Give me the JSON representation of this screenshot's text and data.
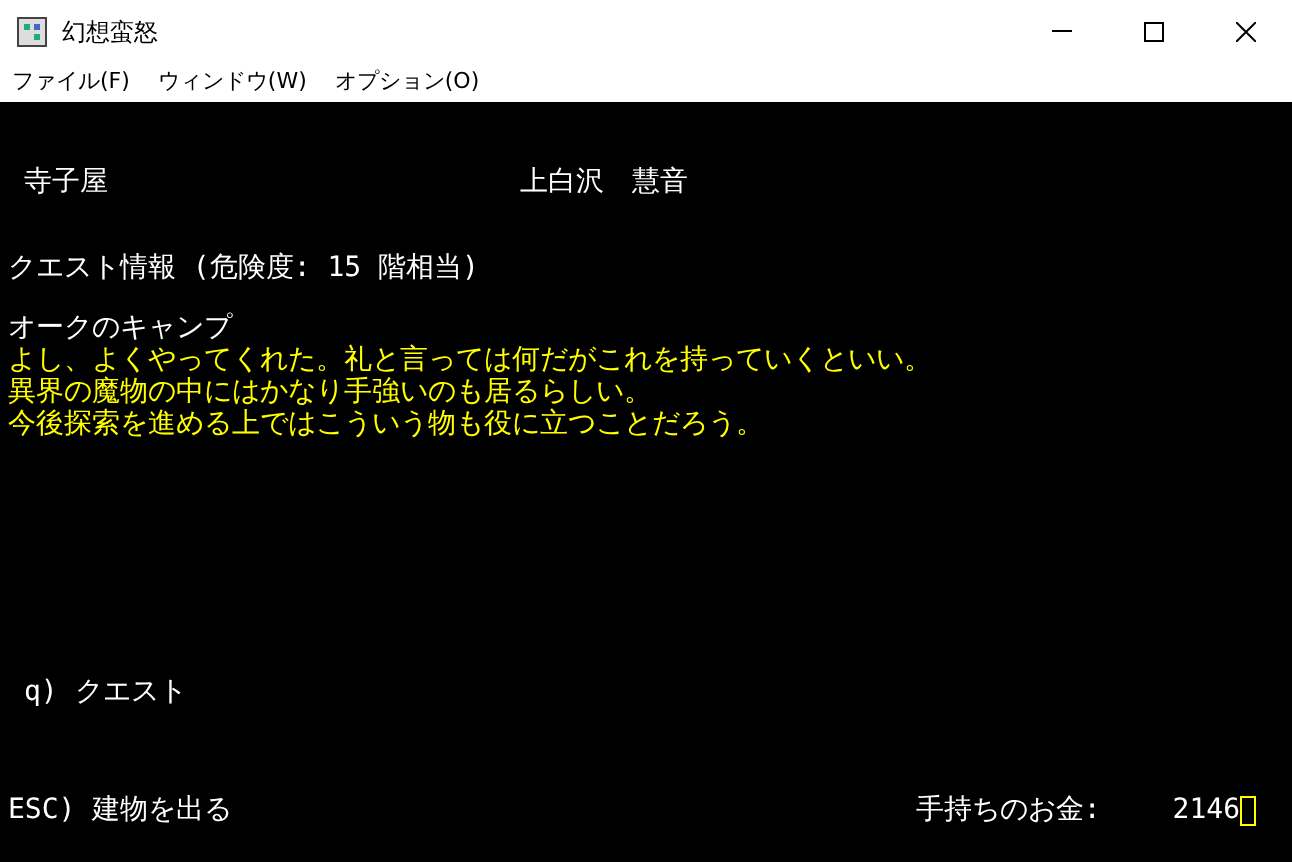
{
  "window": {
    "title": "幻想蛮怒"
  },
  "menu": [
    {
      "label": "ファイル(F)"
    },
    {
      "label": "ウィンドウ(W)"
    },
    {
      "label": "オプション(O)"
    }
  ],
  "header": {
    "location": "寺子屋",
    "npc": "上白沢　慧音"
  },
  "quest": {
    "heading": "クエスト情報 (危険度: 15 階相当)",
    "name": "オークのキャンプ",
    "lines": [
      "よし、よくやってくれた。礼と言っては何だがこれを持っていくといい。",
      "異界の魔物の中にはかなり手強いのも居るらしい。",
      "今後探索を進める上ではこういう物も役に立つことだろう。"
    ]
  },
  "commands": [
    {
      "label": "q) クエスト"
    }
  ],
  "footer": {
    "exit": "ESC) 建物を出る",
    "money_label": "手持ちのお金:",
    "money": "2146",
    "cursor": true
  }
}
